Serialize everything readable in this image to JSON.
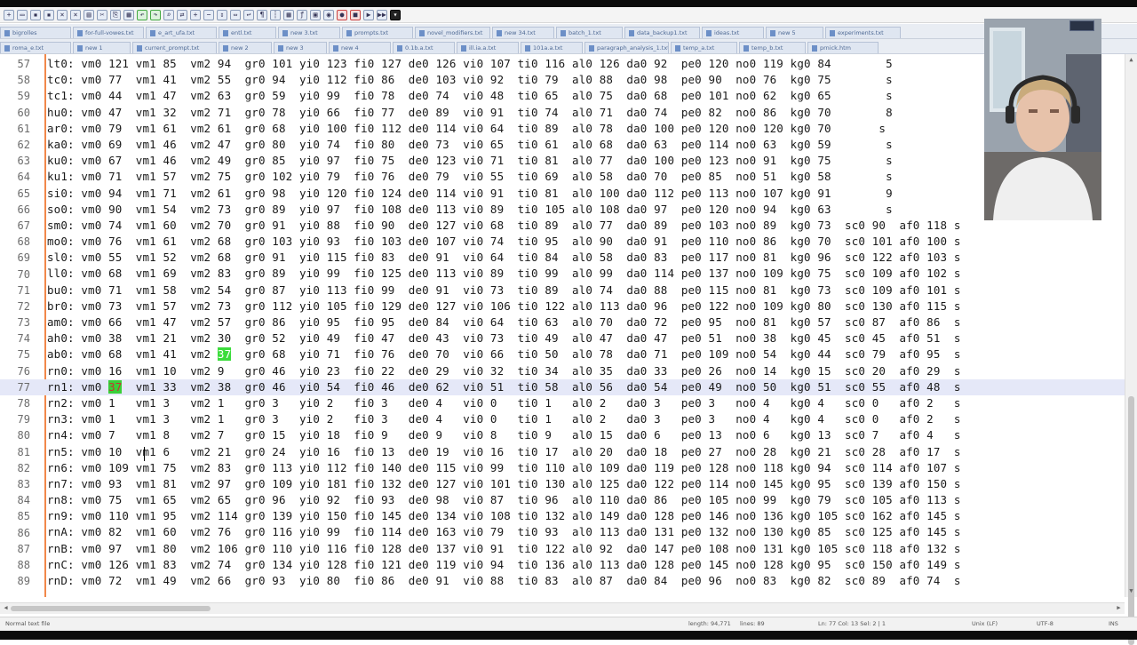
{
  "toolbar": {
    "icons": [
      "new-file-icon",
      "open-file-icon",
      "save-icon",
      "save-all-icon",
      "close-icon",
      "close-all-icon",
      "print-icon",
      "cut-icon",
      "copy-icon",
      "paste-icon",
      "undo-icon",
      "redo-icon",
      "find-icon",
      "replace-icon",
      "zoom-in-icon",
      "zoom-out-icon",
      "sync-v-icon",
      "sync-h-icon",
      "word-wrap-icon",
      "show-all-chars-icon",
      "indent-guide-icon",
      "doc-map-icon",
      "function-list-icon",
      "folder-workspace-icon",
      "monitoring-icon",
      "record-macro-icon",
      "stop-record-icon",
      "play-macro-icon",
      "run-macro-icon",
      "save-macro-icon"
    ]
  },
  "tabs_row1": [
    "bigrolles",
    "for-full-vowes.txt",
    "e_art_ufa.txt",
    "entl.txt",
    "new 3.txt",
    "prompts.txt",
    "novel_modifiers.txt",
    "new 34.txt",
    "batch_1.txt",
    "data_backup1.txt",
    "ideas.txt",
    "new 5",
    "experiments.txt"
  ],
  "tabs_row2": [
    "roma_e.txt",
    "new 1",
    "current_prompt.txt",
    "new 2",
    "new 3",
    "new 4",
    "0.1b.a.txt",
    "ill.ia.a.txt",
    "101a.a.txt",
    "paragraph_analysis_1.txt",
    "temp_a.txt",
    "temp_b.txt",
    "prnick.htm"
  ],
  "editor": {
    "lines": [
      {
        "n": "57",
        "text": "lt0: vm0 121 vm1 85  vm2 94  gr0 101 yi0 123 fi0 127 de0 126 vi0 107 ti0 116 al0 126 da0 92  pe0 120 no0 119 kg0 84        5"
      },
      {
        "n": "58",
        "text": "tc0: vm0 77  vm1 41  vm2 55  gr0 94  yi0 112 fi0 86  de0 103 vi0 92  ti0 79  al0 88  da0 98  pe0 90  no0 76  kg0 75        s"
      },
      {
        "n": "59",
        "text": "tc1: vm0 44  vm1 47  vm2 63  gr0 59  yi0 99  fi0 78  de0 74  vi0 48  ti0 65  al0 75  da0 68  pe0 101 no0 62  kg0 65        s"
      },
      {
        "n": "60",
        "text": "hu0: vm0 47  vm1 32  vm2 71  gr0 78  yi0 66  fi0 77  de0 89  vi0 91  ti0 74  al0 71  da0 74  pe0 82  no0 86  kg0 70        8"
      },
      {
        "n": "61",
        "text": "ar0: vm0 79  vm1 61  vm2 61  gr0 68  yi0 100 fi0 112 de0 114 vi0 64  ti0 89  al0 78  da0 100 pe0 120 no0 120 kg0 70       s"
      },
      {
        "n": "62",
        "text": "ka0: vm0 69  vm1 46  vm2 47  gr0 80  yi0 74  fi0 80  de0 73  vi0 65  ti0 61  al0 68  da0 63  pe0 114 no0 63  kg0 59        s"
      },
      {
        "n": "63",
        "text": "ku0: vm0 67  vm1 46  vm2 49  gr0 85  yi0 97  fi0 75  de0 123 vi0 71  ti0 81  al0 77  da0 100 pe0 123 no0 91  kg0 75        s"
      },
      {
        "n": "64",
        "text": "ku1: vm0 71  vm1 57  vm2 75  gr0 102 yi0 79  fi0 76  de0 79  vi0 55  ti0 69  al0 58  da0 70  pe0 85  no0 51  kg0 58        s"
      },
      {
        "n": "65",
        "text": "si0: vm0 94  vm1 71  vm2 61  gr0 98  yi0 120 fi0 124 de0 114 vi0 91  ti0 81  al0 100 da0 112 pe0 113 no0 107 kg0 91        9"
      },
      {
        "n": "66",
        "text": "so0: vm0 90  vm1 54  vm2 73  gr0 89  yi0 97  fi0 108 de0 113 vi0 89  ti0 105 al0 108 da0 97  pe0 120 no0 94  kg0 63        s"
      },
      {
        "n": "67",
        "text": "sm0: vm0 74  vm1 60  vm2 70  gr0 91  yi0 88  fi0 90  de0 127 vi0 68  ti0 89  al0 77  da0 89  pe0 103 no0 89  kg0 73  sc0 90  af0 118 s"
      },
      {
        "n": "68",
        "text": "mo0: vm0 76  vm1 61  vm2 68  gr0 103 yi0 93  fi0 103 de0 107 vi0 74  ti0 95  al0 90  da0 91  pe0 110 no0 86  kg0 70  sc0 101 af0 100 s"
      },
      {
        "n": "69",
        "text": "sl0: vm0 55  vm1 52  vm2 68  gr0 91  yi0 115 fi0 83  de0 91  vi0 64  ti0 84  al0 58  da0 83  pe0 117 no0 81  kg0 96  sc0 122 af0 103 s"
      },
      {
        "n": "70",
        "text": "ll0: vm0 68  vm1 69  vm2 83  gr0 89  yi0 99  fi0 125 de0 113 vi0 89  ti0 99  al0 99  da0 114 pe0 137 no0 109 kg0 75  sc0 109 af0 102 s"
      },
      {
        "n": "71",
        "text": "bu0: vm0 71  vm1 58  vm2 54  gr0 87  yi0 113 fi0 99  de0 91  vi0 73  ti0 89  al0 74  da0 88  pe0 115 no0 81  kg0 73  sc0 109 af0 101 s"
      },
      {
        "n": "72",
        "text": "br0: vm0 73  vm1 57  vm2 73  gr0 112 yi0 105 fi0 129 de0 127 vi0 106 ti0 122 al0 113 da0 96  pe0 122 no0 109 kg0 80  sc0 130 af0 115 s"
      },
      {
        "n": "73",
        "text": "am0: vm0 66  vm1 47  vm2 57  gr0 86  yi0 95  fi0 95  de0 84  vi0 64  ti0 63  al0 70  da0 72  pe0 95  no0 81  kg0 57  sc0 87  af0 86  s"
      },
      {
        "n": "74",
        "text": "ah0: vm0 38  vm1 21  vm2 30  gr0 52  yi0 49  fi0 47  de0 43  vi0 73  ti0 49  al0 47  da0 47  pe0 51  no0 38  kg0 45  sc0 45  af0 51  s"
      },
      {
        "n": "75",
        "text": "ab0: vm0 68  vm1 41  vm2 37  gr0 68  yi0 71  fi0 76  de0 70  vi0 66  ti0 50  al0 78  da0 71  pe0 109 no0 54  kg0 44  sc0 79  af0 95  s"
      },
      {
        "n": "76",
        "text": "rn0: vm0 16  vm1 10  vm2 9   gr0 46  yi0 23  fi0 22  de0 29  vi0 32  ti0 34  al0 35  da0 33  pe0 26  no0 14  kg0 15  sc0 20  af0 29  s"
      },
      {
        "n": "77",
        "text": "rn1: vm0 37  vm1 33  vm2 38  gr0 46  yi0 54  fi0 46  de0 62  vi0 51  ti0 58  al0 56  da0 54  pe0 49  no0 50  kg0 51  sc0 55  af0 48  s"
      },
      {
        "n": "78",
        "text": "rn2: vm0 1   vm1 3   vm2 1   gr0 3   yi0 2   fi0 3   de0 4   vi0 0   ti0 1   al0 2   da0 3   pe0 3   no0 4   kg0 4   sc0 0   af0 2   s"
      },
      {
        "n": "79",
        "text": "rn3: vm0 1   vm1 3   vm2 1   gr0 3   yi0 2   fi0 3   de0 4   vi0 0   ti0 1   al0 2   da0 3   pe0 3   no0 4   kg0 4   sc0 0   af0 2   s"
      },
      {
        "n": "80",
        "text": "rn4: vm0 7   vm1 8   vm2 7   gr0 15  yi0 18  fi0 9   de0 9   vi0 8   ti0 9   al0 15  da0 6   pe0 13  no0 6   kg0 13  sc0 7   af0 4   s"
      },
      {
        "n": "81",
        "text": "rn5: vm0 10  vm1 6   vm2 21  gr0 24  yi0 16  fi0 13  de0 19  vi0 16  ti0 17  al0 20  da0 18  pe0 27  no0 28  kg0 21  sc0 28  af0 17  s"
      },
      {
        "n": "82",
        "text": "rn6: vm0 109 vm1 75  vm2 83  gr0 113 yi0 112 fi0 140 de0 115 vi0 99  ti0 110 al0 109 da0 119 pe0 128 no0 118 kg0 94  sc0 114 af0 107 s"
      },
      {
        "n": "83",
        "text": "rn7: vm0 93  vm1 81  vm2 97  gr0 109 yi0 181 fi0 132 de0 127 vi0 101 ti0 130 al0 125 da0 122 pe0 114 no0 145 kg0 95  sc0 139 af0 150 s"
      },
      {
        "n": "84",
        "text": "rn8: vm0 75  vm1 65  vm2 65  gr0 96  yi0 92  fi0 93  de0 98  vi0 87  ti0 96  al0 110 da0 86  pe0 105 no0 99  kg0 79  sc0 105 af0 113 s"
      },
      {
        "n": "85",
        "text": "rn9: vm0 110 vm1 95  vm2 114 gr0 139 yi0 150 fi0 145 de0 134 vi0 108 ti0 132 al0 149 da0 128 pe0 146 no0 136 kg0 105 sc0 162 af0 145 s"
      },
      {
        "n": "86",
        "text": "rnA: vm0 82  vm1 60  vm2 76  gr0 116 yi0 99  fi0 114 de0 163 vi0 79  ti0 93  al0 113 da0 131 pe0 132 no0 130 kg0 85  sc0 125 af0 145 s"
      },
      {
        "n": "87",
        "text": "rnB: vm0 97  vm1 80  vm2 106 gr0 110 yi0 116 fi0 128 de0 137 vi0 91  ti0 122 al0 92  da0 147 pe0 108 no0 131 kg0 105 sc0 118 af0 132 s"
      },
      {
        "n": "88",
        "text": "rnC: vm0 126 vm1 83  vm2 74  gr0 134 yi0 128 fi0 121 de0 119 vi0 94  ti0 136 al0 113 da0 128 pe0 145 no0 128 kg0 95  sc0 150 af0 149 s"
      },
      {
        "n": "89",
        "text": "rnD: vm0 72  vm1 49  vm2 66  gr0 93  yi0 80  fi0 86  de0 91  vi0 88  ti0 83  al0 87  da0 84  pe0 96  no0 83  kg0 82  sc0 89  af0 74  s"
      }
    ],
    "current_line": "77",
    "highlights": [
      {
        "line": "75",
        "token": "37",
        "style": "green"
      },
      {
        "line": "77",
        "token": "37",
        "style": "selected"
      }
    ]
  },
  "status": {
    "file_type": "Normal text file",
    "length": "length: 94,771",
    "lines": "lines: 89",
    "position": "Ln: 77   Col: 13   Sel: 2 | 1",
    "eol": "Unix (LF)",
    "encoding": "UTF-8",
    "mode": "INS"
  },
  "colors": {
    "margin_line": "#f1884a",
    "current_line_bg": "#e5e8f8",
    "highlight_green": "#3cdc3c"
  }
}
